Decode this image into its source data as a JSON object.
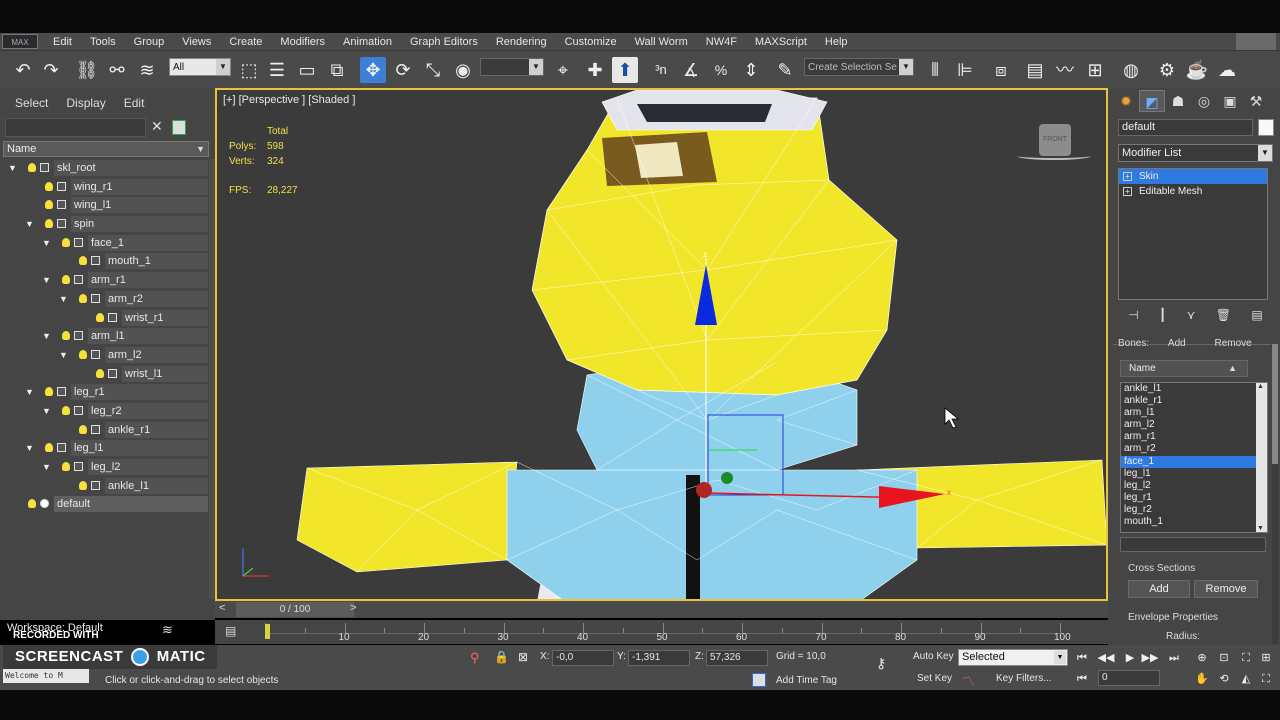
{
  "menu": {
    "logo": "MAX",
    "items": [
      "Edit",
      "Tools",
      "Group",
      "Views",
      "Create",
      "Modifiers",
      "Animation",
      "Graph Editors",
      "Rendering",
      "Customize",
      "Wall Worm",
      "NW4F",
      "MAXScript",
      "Help"
    ]
  },
  "toolbar": {
    "filter_value": "All",
    "selection_set_placeholder": "Create Selection Se"
  },
  "explorer": {
    "tabs": [
      "Select",
      "Display",
      "Edit"
    ],
    "column_header": "Name",
    "rows": [
      {
        "label": "skl_root",
        "depth": 0,
        "twist": "▼",
        "sel": false
      },
      {
        "label": "wing_r1",
        "depth": 1,
        "twist": "",
        "sel": false
      },
      {
        "label": "wing_l1",
        "depth": 1,
        "twist": "",
        "sel": false
      },
      {
        "label": "spin",
        "depth": 1,
        "twist": "▼",
        "sel": false
      },
      {
        "label": "face_1",
        "depth": 2,
        "twist": "▼",
        "sel": false
      },
      {
        "label": "mouth_1",
        "depth": 3,
        "twist": "",
        "sel": false
      },
      {
        "label": "arm_r1",
        "depth": 2,
        "twist": "▼",
        "sel": false
      },
      {
        "label": "arm_r2",
        "depth": 3,
        "twist": "▼",
        "sel": false
      },
      {
        "label": "wrist_r1",
        "depth": 4,
        "twist": "",
        "sel": false
      },
      {
        "label": "arm_l1",
        "depth": 2,
        "twist": "▼",
        "sel": false
      },
      {
        "label": "arm_l2",
        "depth": 3,
        "twist": "▼",
        "sel": false
      },
      {
        "label": "wrist_l1",
        "depth": 4,
        "twist": "",
        "sel": false
      },
      {
        "label": "leg_r1",
        "depth": 1,
        "twist": "▼",
        "sel": false
      },
      {
        "label": "leg_r2",
        "depth": 2,
        "twist": "▼",
        "sel": false
      },
      {
        "label": "ankle_r1",
        "depth": 3,
        "twist": "",
        "sel": false
      },
      {
        "label": "leg_l1",
        "depth": 1,
        "twist": "▼",
        "sel": false
      },
      {
        "label": "leg_l2",
        "depth": 2,
        "twist": "▼",
        "sel": false
      },
      {
        "label": "ankle_l1",
        "depth": 3,
        "twist": "",
        "sel": false
      },
      {
        "label": "default",
        "depth": 0,
        "twist": "",
        "sel": true
      }
    ],
    "workspace": "Workspace: Default"
  },
  "viewport": {
    "label": "[+] [Perspective ] [Shaded ]",
    "stats_header": "Total",
    "polys_label": "Polys:",
    "polys": "598",
    "verts_label": "Verts:",
    "verts": "324",
    "fps_label": "FPS:",
    "fps": "28,227",
    "viewcube": "FRONT",
    "gizmo_z": "z",
    "gizmo_x": "x"
  },
  "timeline": {
    "slider": "0 / 100",
    "ticks": [
      "10",
      "20",
      "30",
      "40",
      "50",
      "60",
      "70",
      "80",
      "90",
      "100"
    ]
  },
  "status": {
    "recorded": "RECORDED WITH",
    "screencast": "SCREENCAST",
    "screencast_tail": "MATIC",
    "listener": "Welcome to M",
    "prompt": "Click or click-and-drag to select objects",
    "x_label": "X:",
    "x": "-0,0",
    "y_label": "Y:",
    "y": "-1,391",
    "z_label": "Z:",
    "z": "57,326",
    "grid": "Grid = 10,0",
    "add_time_tag": "Add Time Tag",
    "auto_key": "Auto Key",
    "set_key": "Set Key",
    "selected": "Selected",
    "key_filters": "Key Filters...",
    "frame": "0"
  },
  "command": {
    "object_name": "default",
    "modifier_list": "Modifier List",
    "stack": [
      {
        "label": "Skin",
        "sel": true
      },
      {
        "label": "Editable Mesh",
        "sel": false
      }
    ],
    "bones_label": "Bones:",
    "bones_add": "Add",
    "bones_remove": "Remove",
    "name_header": "Name",
    "bones": [
      "ankle_l1",
      "ankle_r1",
      "arm_l1",
      "arm_l2",
      "arm_r1",
      "arm_r2",
      "face_1",
      "leg_l1",
      "leg_l2",
      "leg_r1",
      "leg_r2",
      "mouth_1"
    ],
    "selected_bone": "face_1",
    "cross_sections": "Cross Sections",
    "add": "Add",
    "remove": "Remove",
    "envelope_properties": "Envelope Properties",
    "radius": "Radius:"
  },
  "colors": {
    "mesh_yellow": "#f2e62a",
    "mesh_blue": "#8fd1ec",
    "selection_blue": "#2f7ae0",
    "viewport_border": "#e8c23a"
  }
}
